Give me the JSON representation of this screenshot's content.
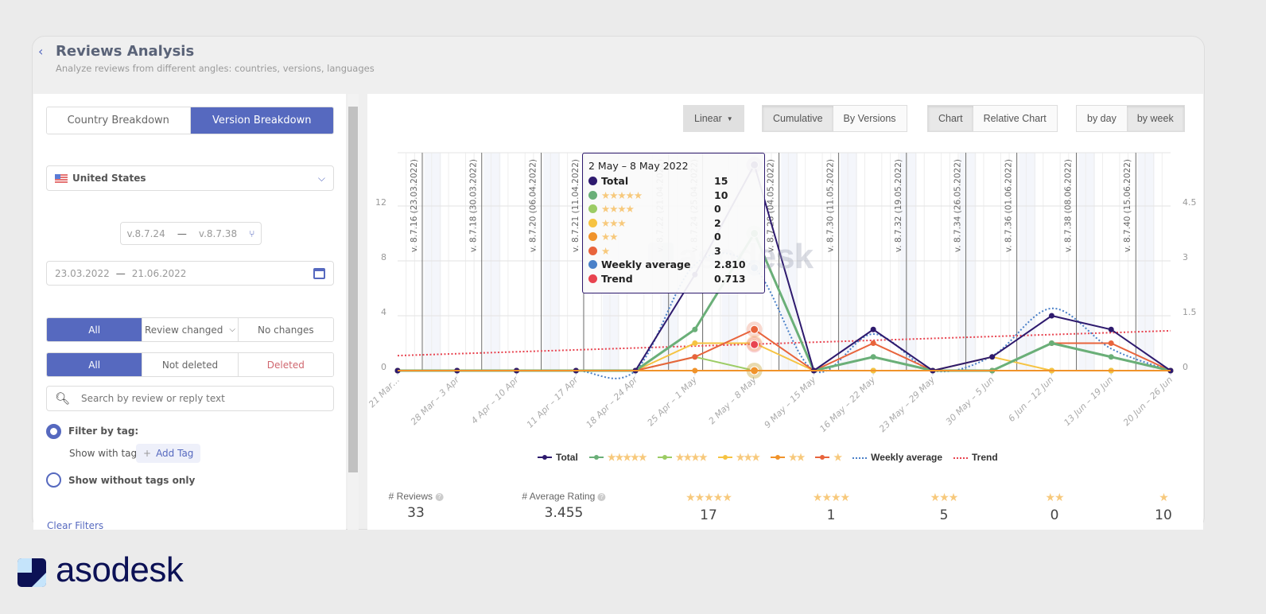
{
  "header": {
    "title": "Reviews Analysis",
    "subtitle": "Analyze reviews from different angles: countries, versions, languages"
  },
  "filters": {
    "breakdown_tabs": [
      "Country Breakdown",
      "Version Breakdown"
    ],
    "country": "United States",
    "version_from": "v.8.7.24",
    "version_to": "v.8.7.38",
    "dash": "—",
    "date_from": "23.03.2022",
    "date_to": "21.06.2022",
    "change_filter": [
      "All",
      "Review changed",
      "No changes"
    ],
    "deleted_filter": [
      "All",
      "Not deleted",
      "Deleted"
    ],
    "search_placeholder": "Search by review or reply text",
    "filter_by_tag": "Filter by tag:",
    "show_with_tag": "Show with tag:",
    "add_tag": "Add Tag",
    "show_without_tags": "Show without tags only",
    "clear_filters": "Clear Filters"
  },
  "toolbar": {
    "scale": "Linear",
    "mode": [
      "Cumulative",
      "By Versions"
    ],
    "view": [
      "Chart",
      "Relative Chart"
    ],
    "period": [
      "by day",
      "by week"
    ]
  },
  "tooltip": {
    "title": "2 May – 8 May 2022",
    "rows": [
      {
        "label": "Total",
        "value": "15",
        "color": "#2e1a6e"
      },
      {
        "label": "★★★★★",
        "value": "10",
        "color": "#6aaf78",
        "stars": true
      },
      {
        "label": "★★★★",
        "value": "0",
        "color": "#9ccc65",
        "stars": true
      },
      {
        "label": "★★★",
        "value": "2",
        "color": "#f6c342",
        "stars": true
      },
      {
        "label": "★★",
        "value": "0",
        "color": "#f0932b",
        "stars": true
      },
      {
        "label": "★",
        "value": "3",
        "color": "#e8643c",
        "stars": true
      },
      {
        "label": "Weekly average",
        "value": "2.810",
        "color": "#4a80c8"
      },
      {
        "label": "Trend",
        "value": "0.713",
        "color": "#e8434f"
      }
    ]
  },
  "watermark": "asodesk",
  "chart_data": {
    "type": "line",
    "categories": [
      "21 Mar…",
      "28 Mar – 3 Apr",
      "4 Apr – 10 Apr",
      "11 Apr – 17 Apr",
      "18 Apr – 24 Apr",
      "25 Apr – 1 May",
      "2 May – 8 May",
      "9 May – 15 May",
      "16 May – 22 May",
      "23 May – 29 May",
      "30 May – 5 Jun",
      "6 Jun – 12 Jun",
      "13 Jun – 19 Jun",
      "20 Jun – 26 Jun"
    ],
    "y_left": {
      "ticks": [
        "0",
        "4",
        "8",
        "12"
      ],
      "range": [
        0,
        16
      ]
    },
    "y_right": {
      "ticks": [
        "0",
        "1.5",
        "3",
        "4.5"
      ],
      "range": [
        0,
        6
      ]
    },
    "series": [
      {
        "name": "Total",
        "color": "#2e1a6e",
        "axis": "left",
        "values": [
          0,
          0,
          0,
          0,
          0,
          7,
          15,
          0,
          3,
          0,
          1,
          4,
          3,
          0
        ]
      },
      {
        "name": "★★★★★",
        "color": "#6aaf78",
        "axis": "left",
        "values": [
          0,
          0,
          0,
          0,
          0,
          3,
          10,
          0,
          1,
          0,
          0,
          2,
          1,
          0
        ]
      },
      {
        "name": "★★★★",
        "color": "#9ccc65",
        "axis": "left",
        "values": [
          0,
          0,
          0,
          0,
          0,
          1,
          0,
          0,
          0,
          0,
          0,
          0,
          0,
          0
        ]
      },
      {
        "name": "★★★",
        "color": "#f6c342",
        "axis": "left",
        "values": [
          0,
          0,
          0,
          0,
          0,
          2,
          2,
          0,
          0,
          0,
          1,
          0,
          0,
          0
        ]
      },
      {
        "name": "★★",
        "color": "#f0932b",
        "axis": "left",
        "values": [
          0,
          0,
          0,
          0,
          0,
          0,
          0,
          0,
          0,
          0,
          0,
          0,
          0,
          0
        ]
      },
      {
        "name": "★",
        "color": "#e8643c",
        "axis": "left",
        "values": [
          0,
          0,
          0,
          0,
          0,
          1,
          3,
          0,
          2,
          0,
          0,
          2,
          2,
          0
        ]
      },
      {
        "name": "Weekly average",
        "color": "#4a80c8",
        "axis": "right",
        "style": "dotted",
        "values": [
          0,
          0,
          0,
          0,
          0,
          2.9,
          2.81,
          0,
          1.0,
          0,
          0.4,
          1.7,
          0.6,
          0
        ]
      },
      {
        "name": "Trend",
        "color": "#e8434f",
        "axis": "right",
        "style": "dotted",
        "values": [
          0.41,
          0.46,
          0.51,
          0.57,
          0.62,
          0.67,
          0.713,
          0.77,
          0.83,
          0.88,
          0.93,
          0.98,
          1.04,
          1.09
        ]
      }
    ],
    "versions": [
      {
        "label": "v. 8.7.16 (23.03.2022)",
        "day": 2
      },
      {
        "label": "v. 8.7.18 (30.03.2022)",
        "day": 9
      },
      {
        "label": "v. 8.7.20 (06.04.2022)",
        "day": 16
      },
      {
        "label": "v. 8.7.21 (11.04.2022)",
        "day": 21
      },
      {
        "label": "v. 8.7.22 (21.04.2022)",
        "day": 31
      },
      {
        "label": "v. 8.7.24 (25.04.2022)",
        "day": 35
      },
      {
        "label": "v. 8.7.28 (04.05.2022)",
        "day": 44
      },
      {
        "label": "v. 8.7.30 (11.05.2022)",
        "day": 51
      },
      {
        "label": "v. 8.7.32 (19.05.2022)",
        "day": 59
      },
      {
        "label": "v. 8.7.34 (26.05.2022)",
        "day": 66
      },
      {
        "label": "v. 8.7.36 (01.06.2022)",
        "day": 72
      },
      {
        "label": "v. 8.7.38 (08.06.2022)",
        "day": 79
      },
      {
        "label": "v. 8.7.40 (15.06.2022)",
        "day": 86
      }
    ],
    "highlighted_category": "2 May – 8 May",
    "legend_position": "bottom"
  },
  "stats": [
    {
      "label": "# Reviews",
      "value": "33",
      "help": true
    },
    {
      "label": "# Average Rating",
      "value": "3.455",
      "help": true
    },
    {
      "label": "★★★★★",
      "value": "17",
      "stars": true
    },
    {
      "label": "★★★★",
      "value": "1",
      "stars": true
    },
    {
      "label": "★★★",
      "value": "5",
      "stars": true
    },
    {
      "label": "★★",
      "value": "0",
      "stars": true
    },
    {
      "label": "★",
      "value": "10",
      "stars": true
    }
  ],
  "brand": {
    "name": "asodesk"
  }
}
